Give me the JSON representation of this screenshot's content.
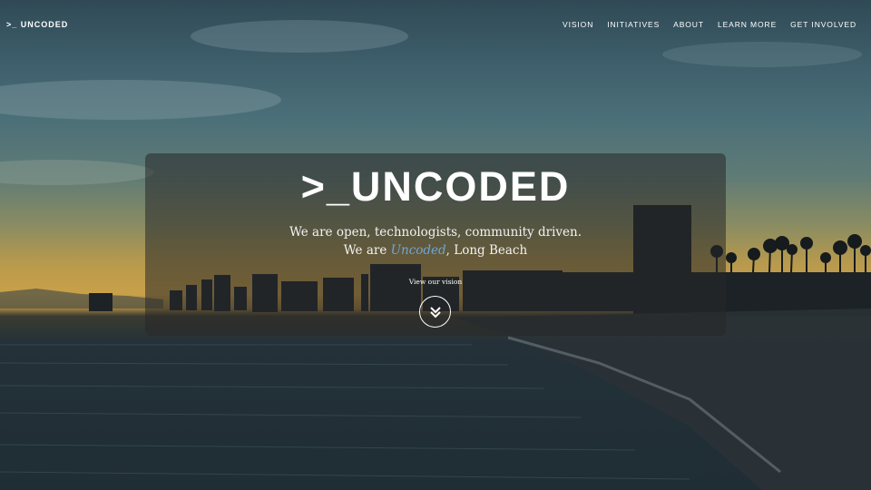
{
  "header": {
    "brand": ">_ UNCODED",
    "nav": [
      "VISION",
      "INITIATIVES",
      "ABOUT",
      "LEARN MORE",
      "GET INVOLVED"
    ]
  },
  "hero": {
    "title": ">_UNCODED",
    "line1": "We are open, technologists, community driven.",
    "line2_prefix": "We are ",
    "line2_accent": "Uncoded",
    "line2_suffix": ", Long Beach",
    "vision_link": "View our vision",
    "scroll_icon": "double-chevron-down-icon"
  },
  "background": {
    "description_icon": "city-skyline-sunset-photo",
    "accent_color": "#6fa6d6"
  }
}
